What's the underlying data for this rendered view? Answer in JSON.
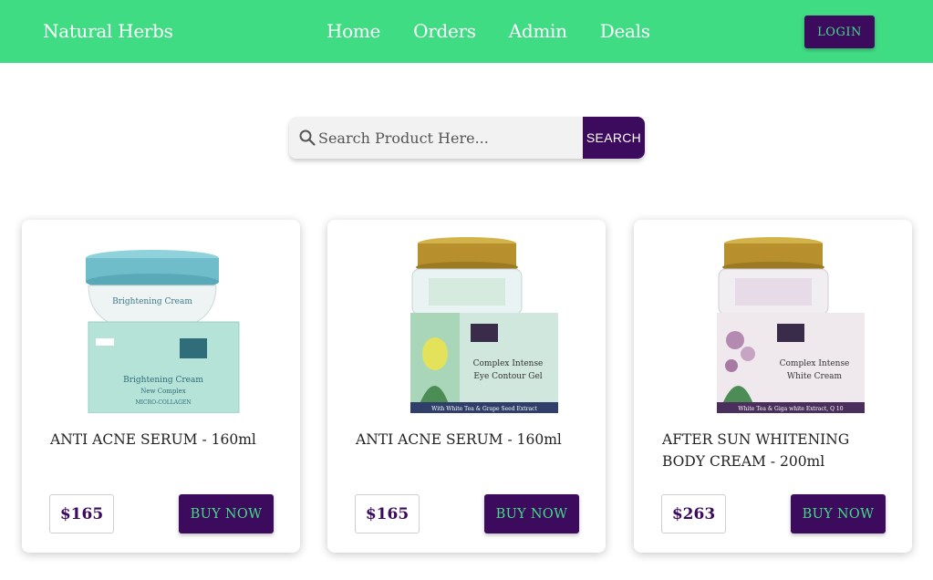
{
  "navbar": {
    "brand": "Natural Herbs",
    "links": [
      "Home",
      "Orders",
      "Admin",
      "Deals"
    ],
    "login_label": "LOGIN"
  },
  "search": {
    "placeholder": "Search Product Here...",
    "button_label": "SEARCH"
  },
  "products": [
    {
      "title": "ANTI ACNE SERUM - 160ml",
      "price": "$165",
      "button_label": "BUY NOW",
      "image_icon": "brightening-cream-jar",
      "box_text": [
        "Brightening Cream",
        "New Complex",
        "MICRO-COLLAGEN"
      ]
    },
    {
      "title": "ANTI ACNE SERUM - 160ml",
      "price": "$165",
      "button_label": "BUY NOW",
      "image_icon": "eye-contour-gel-jar",
      "box_text": [
        "Complex Intense",
        "Eye Contour Gel",
        "With White Tea & Grape Seed Extract"
      ]
    },
    {
      "title": "AFTER SUN WHITENING BODY CREAM - 200ml",
      "price": "$263",
      "button_label": "BUY NOW",
      "image_icon": "white-cream-jar",
      "box_text": [
        "Complex Intense",
        "White Cream",
        "White Tea & Giga white Extract, Q 10"
      ]
    }
  ],
  "colors": {
    "accent_green": "#40dc84",
    "brand_purple": "#3d0b5e"
  }
}
